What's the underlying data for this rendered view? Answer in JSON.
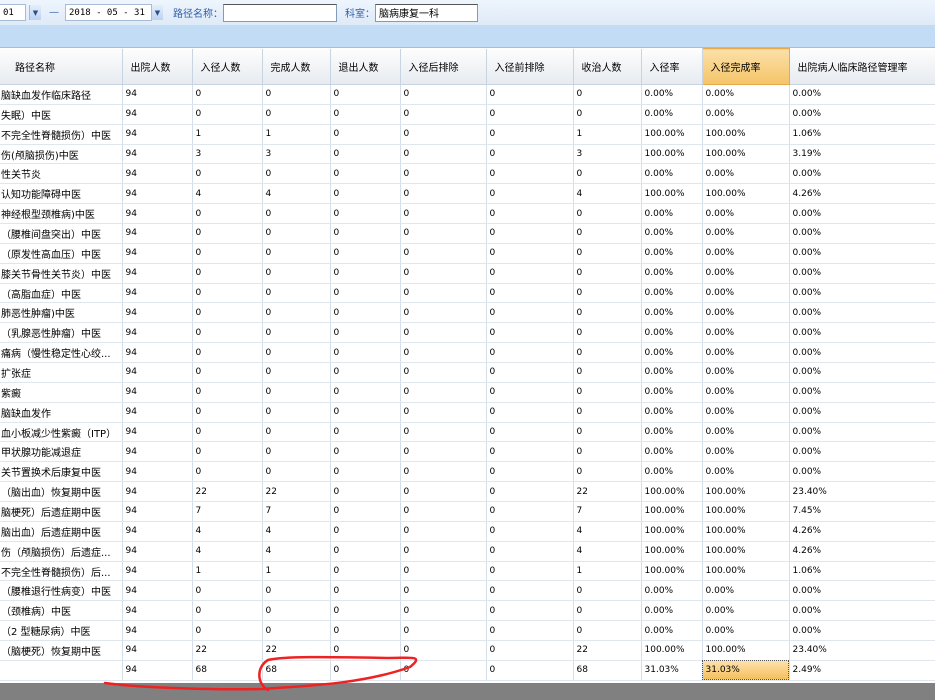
{
  "filters": {
    "start_date_tail": "01",
    "dash": "—",
    "end_date": "2018 - 05 - 31",
    "path_name_label": "路径名称：",
    "path_name_value": "",
    "dept_label": "科室：",
    "dept_value": "脑病康复一科"
  },
  "columns": [
    "路径名称",
    "出院人数",
    "入径人数",
    "完成人数",
    "退出人数",
    "入径后排除",
    "入径前排除",
    "收治人数",
    "入径率",
    "入径完成率",
    "出院病人临床路径管理率"
  ],
  "rows": [
    [
      "脑缺血发作临床路径",
      "94",
      "0",
      "0",
      "0",
      "0",
      "0",
      "0",
      "0.00%",
      "0.00%",
      "0.00%"
    ],
    [
      "失眠）中医",
      "94",
      "0",
      "0",
      "0",
      "0",
      "0",
      "0",
      "0.00%",
      "0.00%",
      "0.00%"
    ],
    [
      "不完全性脊髓损伤）中医",
      "94",
      "1",
      "1",
      "0",
      "0",
      "0",
      "1",
      "100.00%",
      "100.00%",
      "1.06%"
    ],
    [
      "伤(颅脑损伤)中医",
      "94",
      "3",
      "3",
      "0",
      "0",
      "0",
      "3",
      "100.00%",
      "100.00%",
      "3.19%"
    ],
    [
      "性关节炎",
      "94",
      "0",
      "0",
      "0",
      "0",
      "0",
      "0",
      "0.00%",
      "0.00%",
      "0.00%"
    ],
    [
      "认知功能障碍中医",
      "94",
      "4",
      "4",
      "0",
      "0",
      "0",
      "4",
      "100.00%",
      "100.00%",
      "4.26%"
    ],
    [
      "神经根型颈椎病)中医",
      "94",
      "0",
      "0",
      "0",
      "0",
      "0",
      "0",
      "0.00%",
      "0.00%",
      "0.00%"
    ],
    [
      "（腰椎间盘突出）中医",
      "94",
      "0",
      "0",
      "0",
      "0",
      "0",
      "0",
      "0.00%",
      "0.00%",
      "0.00%"
    ],
    [
      "（原发性高血压）中医",
      "94",
      "0",
      "0",
      "0",
      "0",
      "0",
      "0",
      "0.00%",
      "0.00%",
      "0.00%"
    ],
    [
      "膝关节骨性关节炎）中医",
      "94",
      "0",
      "0",
      "0",
      "0",
      "0",
      "0",
      "0.00%",
      "0.00%",
      "0.00%"
    ],
    [
      "（高脂血症）中医",
      "94",
      "0",
      "0",
      "0",
      "0",
      "0",
      "0",
      "0.00%",
      "0.00%",
      "0.00%"
    ],
    [
      "肺恶性肿瘤)中医",
      "94",
      "0",
      "0",
      "0",
      "0",
      "0",
      "0",
      "0.00%",
      "0.00%",
      "0.00%"
    ],
    [
      "（乳腺恶性肿瘤）中医",
      "94",
      "0",
      "0",
      "0",
      "0",
      "0",
      "0",
      "0.00%",
      "0.00%",
      "0.00%"
    ],
    [
      "痛病（慢性稳定性心绞...",
      "94",
      "0",
      "0",
      "0",
      "0",
      "0",
      "0",
      "0.00%",
      "0.00%",
      "0.00%"
    ],
    [
      "扩张症",
      "94",
      "0",
      "0",
      "0",
      "0",
      "0",
      "0",
      "0.00%",
      "0.00%",
      "0.00%"
    ],
    [
      "紫癜",
      "94",
      "0",
      "0",
      "0",
      "0",
      "0",
      "0",
      "0.00%",
      "0.00%",
      "0.00%"
    ],
    [
      "脑缺血发作",
      "94",
      "0",
      "0",
      "0",
      "0",
      "0",
      "0",
      "0.00%",
      "0.00%",
      "0.00%"
    ],
    [
      "血小板减少性紫癜（ITP）",
      "94",
      "0",
      "0",
      "0",
      "0",
      "0",
      "0",
      "0.00%",
      "0.00%",
      "0.00%"
    ],
    [
      "甲状腺功能减退症",
      "94",
      "0",
      "0",
      "0",
      "0",
      "0",
      "0",
      "0.00%",
      "0.00%",
      "0.00%"
    ],
    [
      "关节置换术后康复中医",
      "94",
      "0",
      "0",
      "0",
      "0",
      "0",
      "0",
      "0.00%",
      "0.00%",
      "0.00%"
    ],
    [
      "（脑出血）恢复期中医",
      "94",
      "22",
      "22",
      "0",
      "0",
      "0",
      "22",
      "100.00%",
      "100.00%",
      "23.40%"
    ],
    [
      "脑梗死）后遗症期中医",
      "94",
      "7",
      "7",
      "0",
      "0",
      "0",
      "7",
      "100.00%",
      "100.00%",
      "7.45%"
    ],
    [
      "脑出血）后遗症期中医",
      "94",
      "4",
      "4",
      "0",
      "0",
      "0",
      "4",
      "100.00%",
      "100.00%",
      "4.26%"
    ],
    [
      "伤（颅脑损伤）后遗症...",
      "94",
      "4",
      "4",
      "0",
      "0",
      "0",
      "4",
      "100.00%",
      "100.00%",
      "4.26%"
    ],
    [
      "不完全性脊髓损伤）后...",
      "94",
      "1",
      "1",
      "0",
      "0",
      "0",
      "1",
      "100.00%",
      "100.00%",
      "1.06%"
    ],
    [
      "（腰椎退行性病变）中医",
      "94",
      "0",
      "0",
      "0",
      "0",
      "0",
      "0",
      "0.00%",
      "0.00%",
      "0.00%"
    ],
    [
      "（颈椎病）中医",
      "94",
      "0",
      "0",
      "0",
      "0",
      "0",
      "0",
      "0.00%",
      "0.00%",
      "0.00%"
    ],
    [
      "（2 型糖尿病）中医",
      "94",
      "0",
      "0",
      "0",
      "0",
      "0",
      "0",
      "0.00%",
      "0.00%",
      "0.00%"
    ],
    [
      "（脑梗死）恢复期中医",
      "94",
      "22",
      "22",
      "0",
      "0",
      "0",
      "22",
      "100.00%",
      "100.00%",
      "23.40%"
    ]
  ],
  "total": [
    "",
    "94",
    "68",
    "68",
    "0",
    "0",
    "0",
    "68",
    "31.03%",
    "31.03%",
    "2.49%"
  ],
  "colors": {
    "header_selected": "#f5c468",
    "band": "#c2dcf6",
    "annotation": "#ee2222"
  }
}
